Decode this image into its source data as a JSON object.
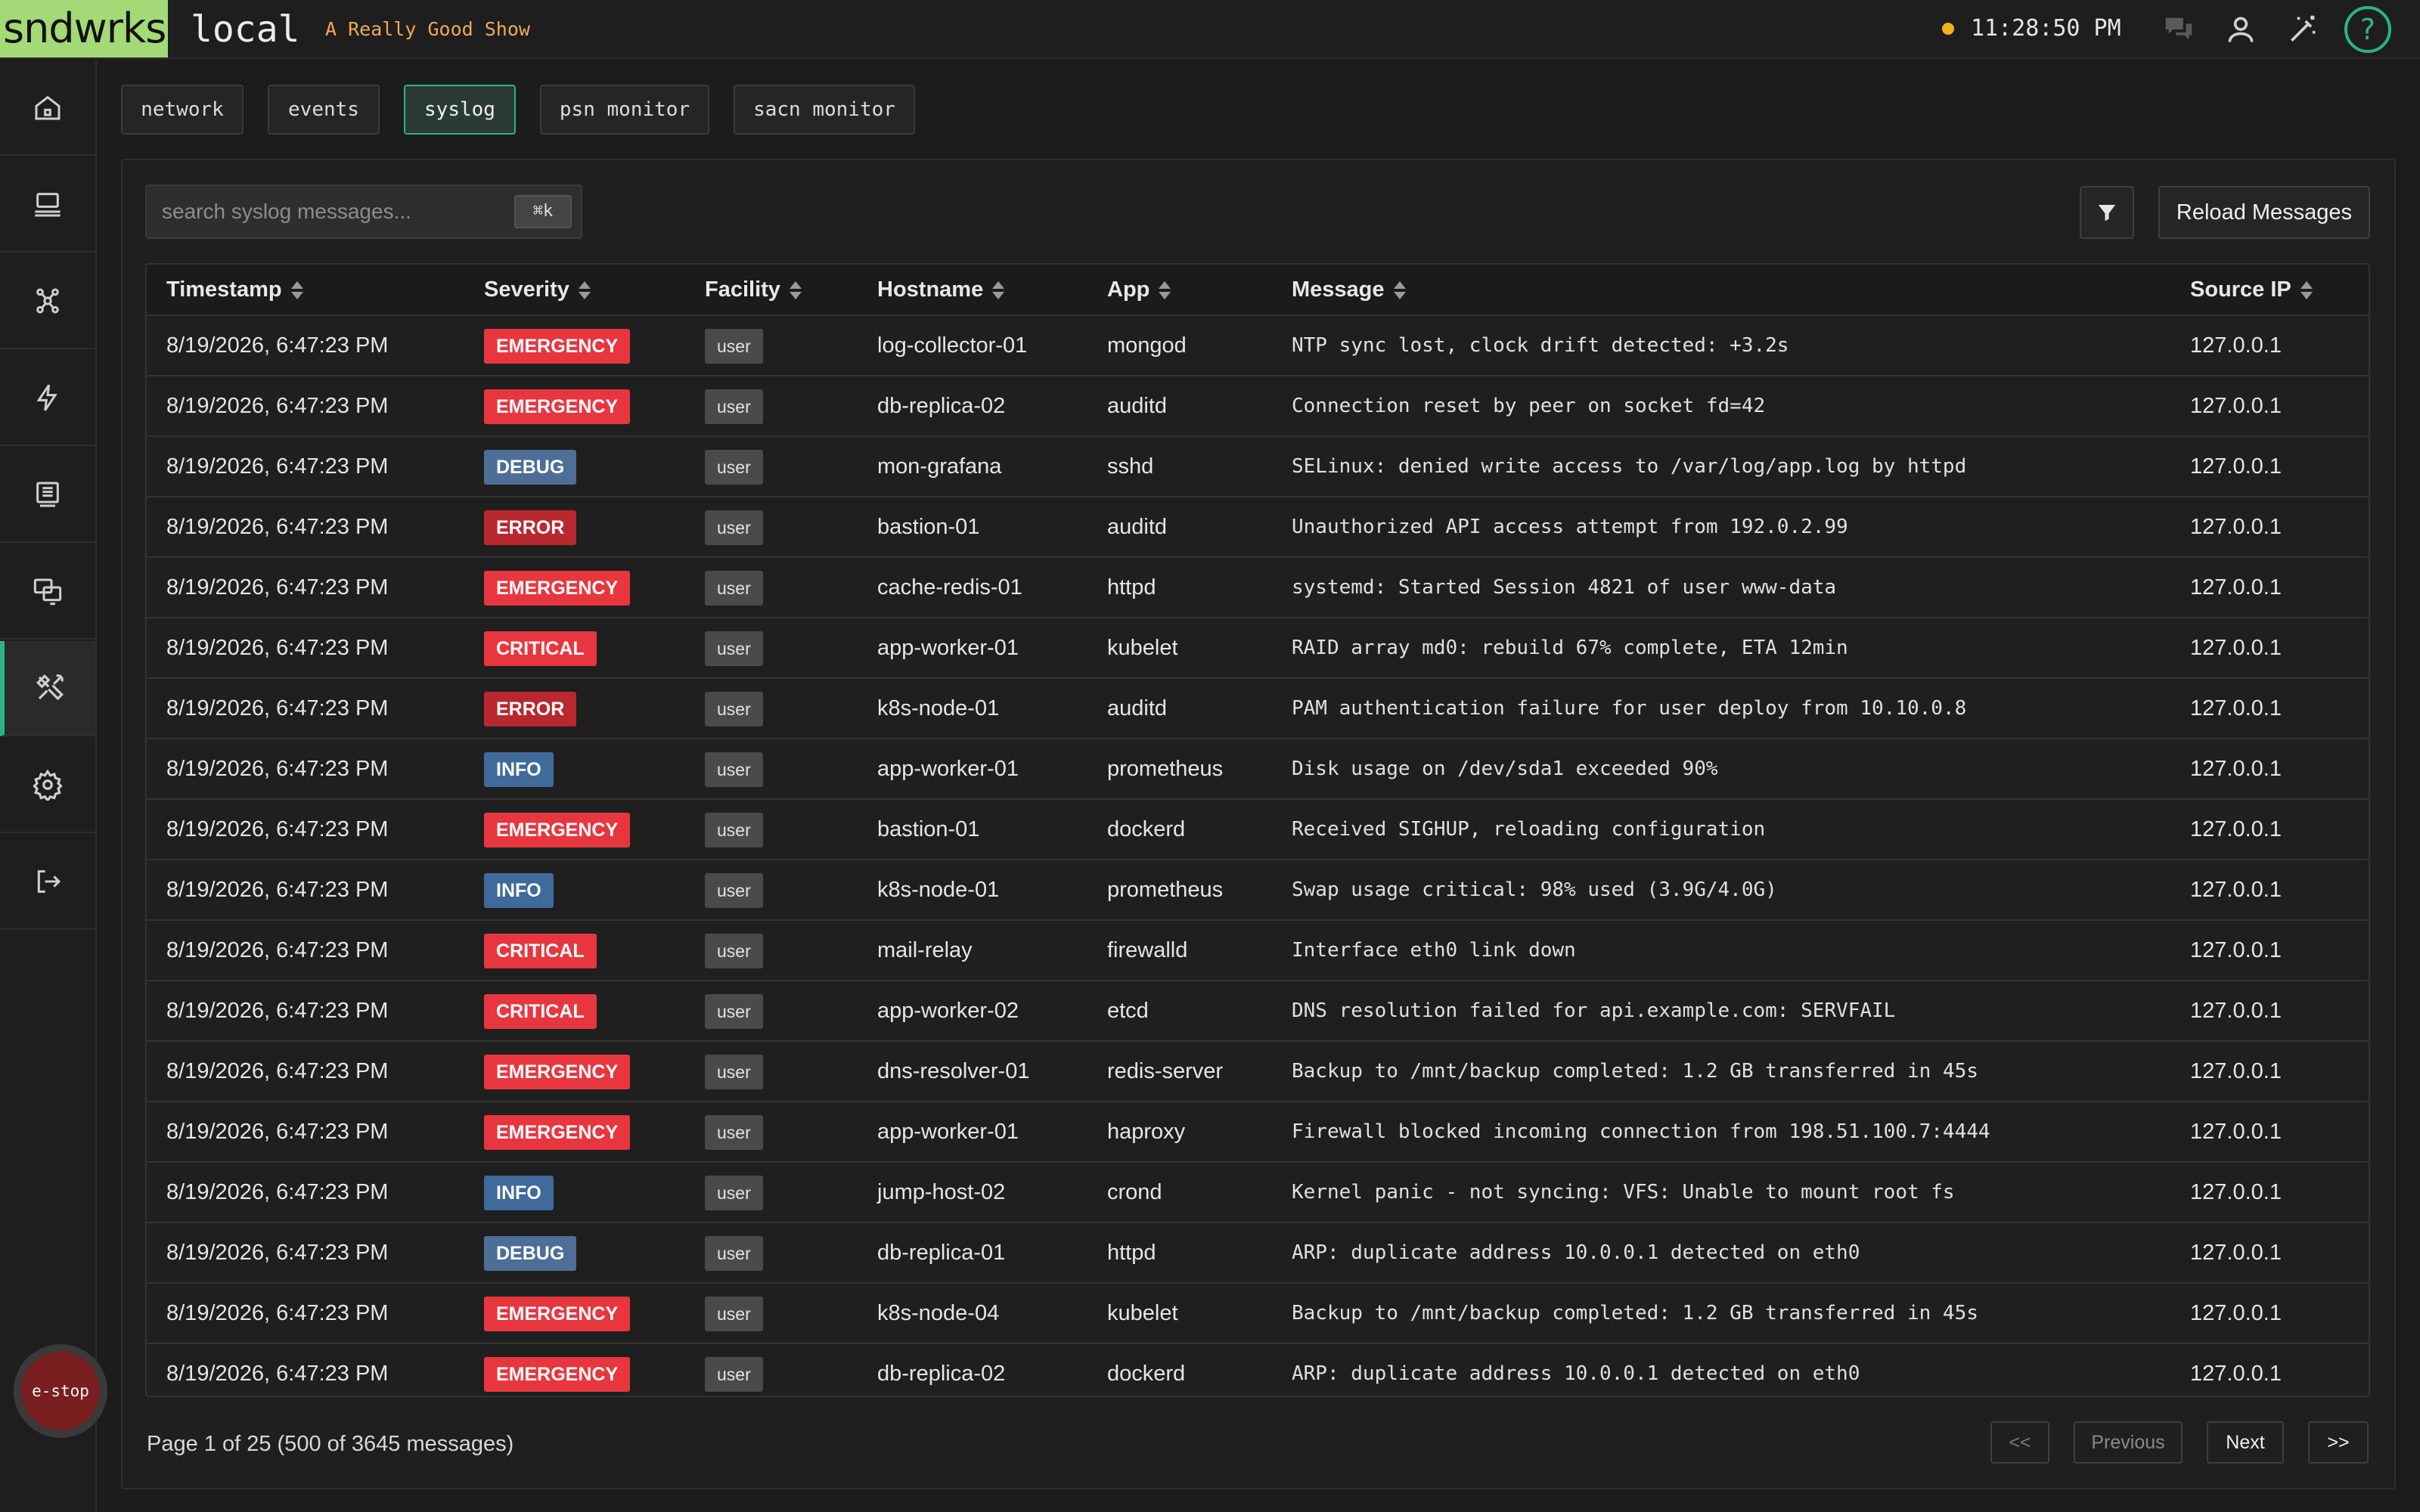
{
  "header": {
    "logo": "sndwrks",
    "environment": "local",
    "show_name": "A Really Good Show",
    "clock": "11:28:50 PM",
    "status_color": "#f2b020"
  },
  "top_icons": [
    "chat-icon",
    "user-icon",
    "magic-wand-icon",
    "help-icon"
  ],
  "help_label": "?",
  "sidebar": {
    "items": [
      {
        "name": "home",
        "icon": "home-icon"
      },
      {
        "name": "network",
        "icon": "network-icon"
      },
      {
        "name": "nodes",
        "icon": "nodes-icon"
      },
      {
        "name": "events",
        "icon": "lightning-icon"
      },
      {
        "name": "show",
        "icon": "display-icon"
      },
      {
        "name": "monitor",
        "icon": "monitors-icon"
      },
      {
        "name": "tools",
        "icon": "tools-icon",
        "active": true
      },
      {
        "name": "settings",
        "icon": "gear-icon"
      },
      {
        "name": "logout",
        "icon": "logout-icon"
      }
    ],
    "estop_label": "e-stop"
  },
  "tabs": [
    {
      "label": "network"
    },
    {
      "label": "events"
    },
    {
      "label": "syslog",
      "active": true
    },
    {
      "label": "psn monitor"
    },
    {
      "label": "sacn monitor"
    }
  ],
  "search": {
    "placeholder": "search syslog messages...",
    "value": "",
    "shortcut": "⌘k"
  },
  "toolbar": {
    "reload_label": "Reload Messages"
  },
  "severity_colors": {
    "EMERGENCY": "#e8363f",
    "CRITICAL": "#e8363f",
    "ERROR": "#b8282e",
    "DEBUG": "#4d6e96",
    "INFO": "#3f6a9a"
  },
  "table": {
    "columns": [
      "Timestamp",
      "Severity",
      "Facility",
      "Hostname",
      "App",
      "Message",
      "Source IP"
    ],
    "rows": [
      {
        "timestamp": "8/19/2026, 6:47:23 PM",
        "severity": "EMERGENCY",
        "facility": "user",
        "hostname": "log-collector-01",
        "app": "mongod",
        "message": "NTP sync lost, clock drift detected: +3.2s",
        "source_ip": "127.0.0.1"
      },
      {
        "timestamp": "8/19/2026, 6:47:23 PM",
        "severity": "EMERGENCY",
        "facility": "user",
        "hostname": "db-replica-02",
        "app": "auditd",
        "message": "Connection reset by peer on socket fd=42",
        "source_ip": "127.0.0.1"
      },
      {
        "timestamp": "8/19/2026, 6:47:23 PM",
        "severity": "DEBUG",
        "facility": "user",
        "hostname": "mon-grafana",
        "app": "sshd",
        "message": "SELinux: denied write access to /var/log/app.log by httpd",
        "source_ip": "127.0.0.1"
      },
      {
        "timestamp": "8/19/2026, 6:47:23 PM",
        "severity": "ERROR",
        "facility": "user",
        "hostname": "bastion-01",
        "app": "auditd",
        "message": "Unauthorized API access attempt from 192.0.2.99",
        "source_ip": "127.0.0.1"
      },
      {
        "timestamp": "8/19/2026, 6:47:23 PM",
        "severity": "EMERGENCY",
        "facility": "user",
        "hostname": "cache-redis-01",
        "app": "httpd",
        "message": "systemd: Started Session 4821 of user www-data",
        "source_ip": "127.0.0.1"
      },
      {
        "timestamp": "8/19/2026, 6:47:23 PM",
        "severity": "CRITICAL",
        "facility": "user",
        "hostname": "app-worker-01",
        "app": "kubelet",
        "message": "RAID array md0: rebuild 67% complete, ETA 12min",
        "source_ip": "127.0.0.1"
      },
      {
        "timestamp": "8/19/2026, 6:47:23 PM",
        "severity": "ERROR",
        "facility": "user",
        "hostname": "k8s-node-01",
        "app": "auditd",
        "message": "PAM authentication failure for user deploy from 10.10.0.8",
        "source_ip": "127.0.0.1"
      },
      {
        "timestamp": "8/19/2026, 6:47:23 PM",
        "severity": "INFO",
        "facility": "user",
        "hostname": "app-worker-01",
        "app": "prometheus",
        "message": "Disk usage on /dev/sda1 exceeded 90%",
        "source_ip": "127.0.0.1"
      },
      {
        "timestamp": "8/19/2026, 6:47:23 PM",
        "severity": "EMERGENCY",
        "facility": "user",
        "hostname": "bastion-01",
        "app": "dockerd",
        "message": "Received SIGHUP, reloading configuration",
        "source_ip": "127.0.0.1"
      },
      {
        "timestamp": "8/19/2026, 6:47:23 PM",
        "severity": "INFO",
        "facility": "user",
        "hostname": "k8s-node-01",
        "app": "prometheus",
        "message": "Swap usage critical: 98% used (3.9G/4.0G)",
        "source_ip": "127.0.0.1"
      },
      {
        "timestamp": "8/19/2026, 6:47:23 PM",
        "severity": "CRITICAL",
        "facility": "user",
        "hostname": "mail-relay",
        "app": "firewalld",
        "message": "Interface eth0 link down",
        "source_ip": "127.0.0.1"
      },
      {
        "timestamp": "8/19/2026, 6:47:23 PM",
        "severity": "CRITICAL",
        "facility": "user",
        "hostname": "app-worker-02",
        "app": "etcd",
        "message": "DNS resolution failed for api.example.com: SERVFAIL",
        "source_ip": "127.0.0.1"
      },
      {
        "timestamp": "8/19/2026, 6:47:23 PM",
        "severity": "EMERGENCY",
        "facility": "user",
        "hostname": "dns-resolver-01",
        "app": "redis-server",
        "message": "Backup to /mnt/backup completed: 1.2 GB transferred in 45s",
        "source_ip": "127.0.0.1"
      },
      {
        "timestamp": "8/19/2026, 6:47:23 PM",
        "severity": "EMERGENCY",
        "facility": "user",
        "hostname": "app-worker-01",
        "app": "haproxy",
        "message": "Firewall blocked incoming connection from 198.51.100.7:4444",
        "source_ip": "127.0.0.1"
      },
      {
        "timestamp": "8/19/2026, 6:47:23 PM",
        "severity": "INFO",
        "facility": "user",
        "hostname": "jump-host-02",
        "app": "crond",
        "message": "Kernel panic - not syncing: VFS: Unable to mount root fs",
        "source_ip": "127.0.0.1"
      },
      {
        "timestamp": "8/19/2026, 6:47:23 PM",
        "severity": "DEBUG",
        "facility": "user",
        "hostname": "db-replica-01",
        "app": "httpd",
        "message": "ARP: duplicate address 10.0.0.1 detected on eth0",
        "source_ip": "127.0.0.1"
      },
      {
        "timestamp": "8/19/2026, 6:47:23 PM",
        "severity": "EMERGENCY",
        "facility": "user",
        "hostname": "k8s-node-04",
        "app": "kubelet",
        "message": "Backup to /mnt/backup completed: 1.2 GB transferred in 45s",
        "source_ip": "127.0.0.1"
      },
      {
        "timestamp": "8/19/2026, 6:47:23 PM",
        "severity": "EMERGENCY",
        "facility": "user",
        "hostname": "db-replica-02",
        "app": "dockerd",
        "message": "ARP: duplicate address 10.0.0.1 detected on eth0",
        "source_ip": "127.0.0.1"
      }
    ]
  },
  "pagination": {
    "info": "Page 1 of 25 (500 of 3645 messages)",
    "first_label": "<<",
    "previous_label": "Previous",
    "next_label": "Next",
    "last_label": ">>"
  }
}
